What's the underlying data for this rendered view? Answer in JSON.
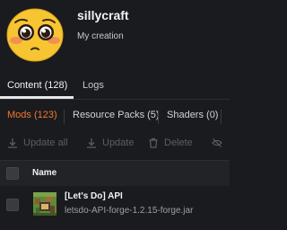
{
  "header": {
    "title": "sillycraft",
    "subtitle": "My creation",
    "avatar_icon": "pleading-face-emoji-icon"
  },
  "tabs": [
    {
      "label": "Content (128)",
      "active": true
    },
    {
      "label": "Logs",
      "active": false
    }
  ],
  "subtabs": [
    {
      "label": "Mods (123)",
      "active": true
    },
    {
      "label": "Resource Packs (5)",
      "active": false
    },
    {
      "label": "Shaders (0)",
      "active": false
    }
  ],
  "actions": [
    {
      "label": "Update all",
      "icon": "download-icon",
      "enabled": false
    },
    {
      "label": "Update",
      "icon": "download-icon",
      "enabled": false
    },
    {
      "label": "Delete",
      "icon": "trash-icon",
      "enabled": false
    },
    {
      "label": "",
      "icon": "eye-off-icon",
      "enabled": false
    }
  ],
  "table": {
    "column_name": "Name",
    "rows": [
      {
        "name": "[Let's Do] API",
        "file": "letsdo-API-forge-1.2.15-forge.jar",
        "icon": "mod-icon"
      }
    ]
  },
  "colors": {
    "background": "#1a1b1e",
    "accent": "#f0782d",
    "text": "#e8e8ea",
    "disabled": "#5d5e64"
  }
}
